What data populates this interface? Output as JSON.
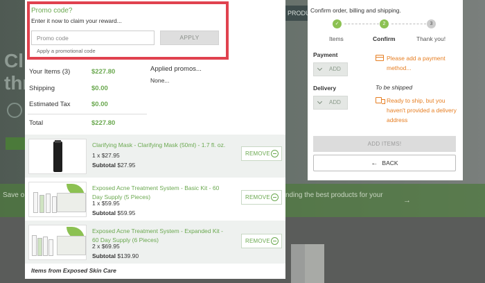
{
  "background": {
    "nav_fragment": "PRODU",
    "heading_fragment": "Cl\nthr",
    "band_left_text": "Save o",
    "band_right_text": "nding the best products for your",
    "band_arrow": "→"
  },
  "promo": {
    "title": "Promo code?",
    "subtitle": "Enter it now to claim your reward...",
    "placeholder": "Promo code",
    "apply_label": "APPLY",
    "hint": "Apply a promotional code"
  },
  "summary": {
    "rows": [
      {
        "label": "Your Items (3)",
        "value": "$227.80"
      },
      {
        "label": "Shipping",
        "value": "$0.00"
      },
      {
        "label": "Estimated Tax",
        "value": "$0.00"
      },
      {
        "label": "Total",
        "value": "$227.80"
      }
    ],
    "applied_label": "Applied promos...",
    "applied_value": "None..."
  },
  "items": [
    {
      "name": "Clarifying Mask - Clarifying Mask (50ml) - 1.7 fl. oz.",
      "qty": "1 x $27.95",
      "subtotal_label": "Subtotal",
      "subtotal": "$27.95",
      "remove_label": "REMOVE"
    },
    {
      "name": "Exposed Acne Treatment System - Basic Kit - 60 Day Supply (5 Pieces)",
      "qty": "1 x $59.95",
      "subtotal_label": "Subtotal",
      "subtotal": "$59.95",
      "remove_label": "REMOVE"
    },
    {
      "name": "Exposed Acne Treatment System - Expanded Kit - 60 Day Supply (6 Pieces)",
      "qty": "2 x $69.95",
      "subtotal_label": "Subtotal",
      "subtotal": "$139.90",
      "remove_label": "REMOVE"
    }
  ],
  "items_footer": "Items from Exposed Skin Care",
  "checkout": {
    "title": "Confirm order, billing and shipping.",
    "steps": [
      {
        "label": "Items",
        "marker": "✓"
      },
      {
        "label": "Confirm",
        "marker": "2"
      },
      {
        "label": "Thank you!",
        "marker": "3"
      }
    ],
    "payment_label": "Payment",
    "payment_add": "ADD",
    "payment_warning": "Please add a payment method...",
    "delivery_label": "Delivery",
    "delivery_add": "ADD",
    "to_be_shipped": "To be shipped",
    "delivery_warning": "Ready to ship, but you haven't provided a delivery address",
    "add_items_label": "ADD ITEMS!",
    "back_label": "BACK",
    "back_arrow": "←"
  },
  "colors": {
    "accent_green": "#6aa84f",
    "step_green": "#8cc152",
    "warning_orange": "#e67e22",
    "promo_highlight": "#e0424f"
  }
}
